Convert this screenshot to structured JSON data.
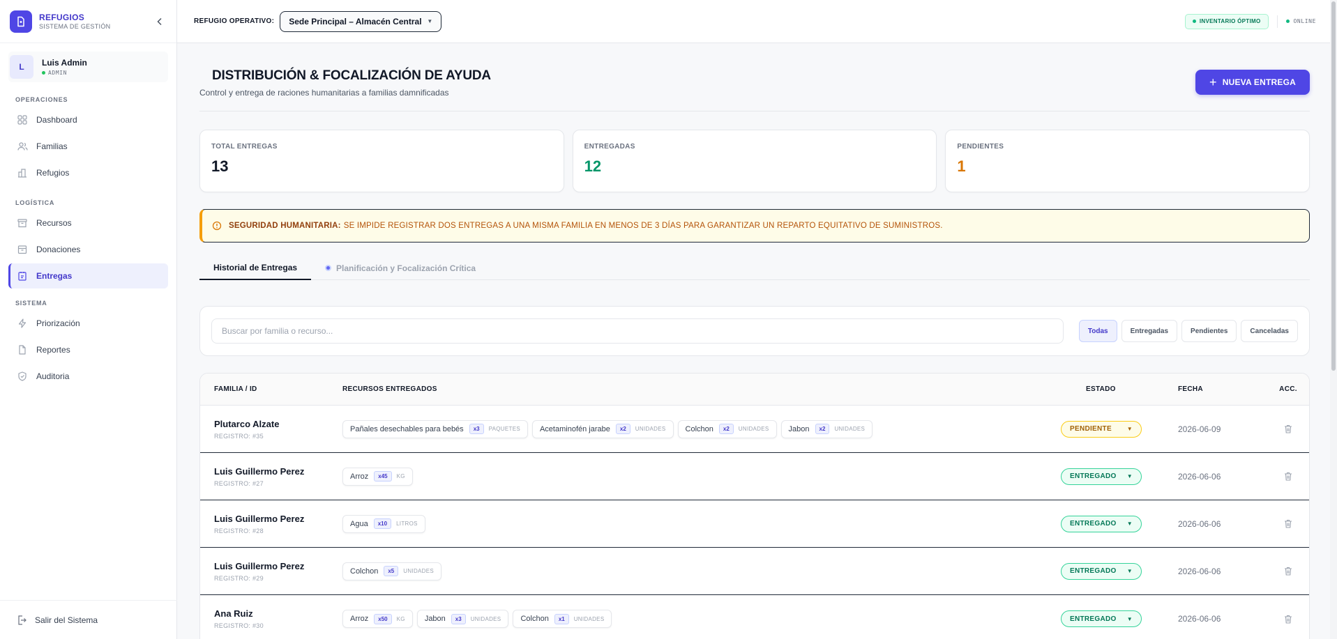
{
  "brand": {
    "title": "REFUGIOS",
    "subtitle": "SISTEMA DE GESTIÓN"
  },
  "user": {
    "initial": "L",
    "name": "Luis Admin",
    "role": "ADMIN"
  },
  "nav": {
    "sections": [
      {
        "label": "OPERACIONES",
        "items": [
          "Dashboard",
          "Familias",
          "Refugios"
        ]
      },
      {
        "label": "LOGÍSTICA",
        "items": [
          "Recursos",
          "Donaciones",
          "Entregas"
        ]
      },
      {
        "label": "SISTEMA",
        "items": [
          "Priorización",
          "Reportes",
          "Auditoria"
        ]
      }
    ],
    "active": "Entregas",
    "logout": "Salir del Sistema"
  },
  "topbar": {
    "op_label": "REFUGIO OPERATIVO:",
    "op_value": "Sede Principal – Almacén Central",
    "inventory_badge": "INVENTARIO ÓPTIMO",
    "status": "ONLINE"
  },
  "page": {
    "title": "DISTRIBUCIÓN & FOCALIZACIÓN DE AYUDA",
    "subtitle": "Control y entrega de raciones humanitarias a familias damnificadas",
    "new_button": "NUEVA ENTREGA"
  },
  "stats": [
    {
      "label": "TOTAL ENTREGAS",
      "value": "13",
      "color": "#111827"
    },
    {
      "label": "ENTREGADAS",
      "value": "12",
      "color": "#059669"
    },
    {
      "label": "PENDIENTES",
      "value": "1",
      "color": "#d97706"
    }
  ],
  "alert": {
    "title": "SEGURIDAD HUMANITARIA:",
    "text": "SE IMPIDE REGISTRAR DOS ENTREGAS A UNA MISMA FAMILIA EN MENOS DE 3 DÍAS PARA GARANTIZAR UN REPARTO EQUITATIVO DE SUMINISTROS."
  },
  "tabs": [
    "Historial de Entregas",
    "Planificación y Focalización Crítica"
  ],
  "filters": {
    "search_placeholder": "Buscar por familia o recurso...",
    "buttons": [
      "Todas",
      "Entregadas",
      "Pendientes",
      "Canceladas"
    ],
    "active": "Todas"
  },
  "table": {
    "headers": [
      "FAMILIA / ID",
      "RECURSOS ENTREGADOS",
      "ESTADO",
      "FECHA",
      "ACC."
    ],
    "rows": [
      {
        "name": "Plutarco Alzate",
        "id": "REGISTRO: #35",
        "status": "PENDIENTE",
        "status_type": "pend",
        "date": "2026-06-09",
        "resources": [
          {
            "name": "Pañales desechables para bebés",
            "qty": "x3",
            "unit": "PAQUETES"
          },
          {
            "name": "Acetaminofén jarabe",
            "qty": "x2",
            "unit": "UNIDADES"
          },
          {
            "name": "Colchon",
            "qty": "x2",
            "unit": "UNIDADES"
          },
          {
            "name": "Jabon",
            "qty": "x2",
            "unit": "UNIDADES"
          }
        ]
      },
      {
        "name": "Luis Guillermo Perez",
        "id": "REGISTRO: #27",
        "status": "ENTREGADO",
        "status_type": "ent",
        "date": "2026-06-06",
        "resources": [
          {
            "name": "Arroz",
            "qty": "x45",
            "unit": "KG"
          }
        ]
      },
      {
        "name": "Luis Guillermo Perez",
        "id": "REGISTRO: #28",
        "status": "ENTREGADO",
        "status_type": "ent",
        "date": "2026-06-06",
        "resources": [
          {
            "name": "Agua",
            "qty": "x10",
            "unit": "LITROS"
          }
        ]
      },
      {
        "name": "Luis Guillermo Perez",
        "id": "REGISTRO: #29",
        "status": "ENTREGADO",
        "status_type": "ent",
        "date": "2026-06-06",
        "resources": [
          {
            "name": "Colchon",
            "qty": "x5",
            "unit": "UNIDADES"
          }
        ]
      },
      {
        "name": "Ana Ruiz",
        "id": "REGISTRO: #30",
        "status": "ENTREGADO",
        "status_type": "ent",
        "date": "2026-06-06",
        "resources": [
          {
            "name": "Arroz",
            "qty": "x50",
            "unit": "KG"
          },
          {
            "name": "Jabon",
            "qty": "x3",
            "unit": "UNIDADES"
          },
          {
            "name": "Colchon",
            "qty": "x1",
            "unit": "UNIDADES"
          }
        ]
      }
    ]
  },
  "colors": {
    "accent": "#4f46e5",
    "success": "#059669",
    "warning": "#d97706"
  }
}
